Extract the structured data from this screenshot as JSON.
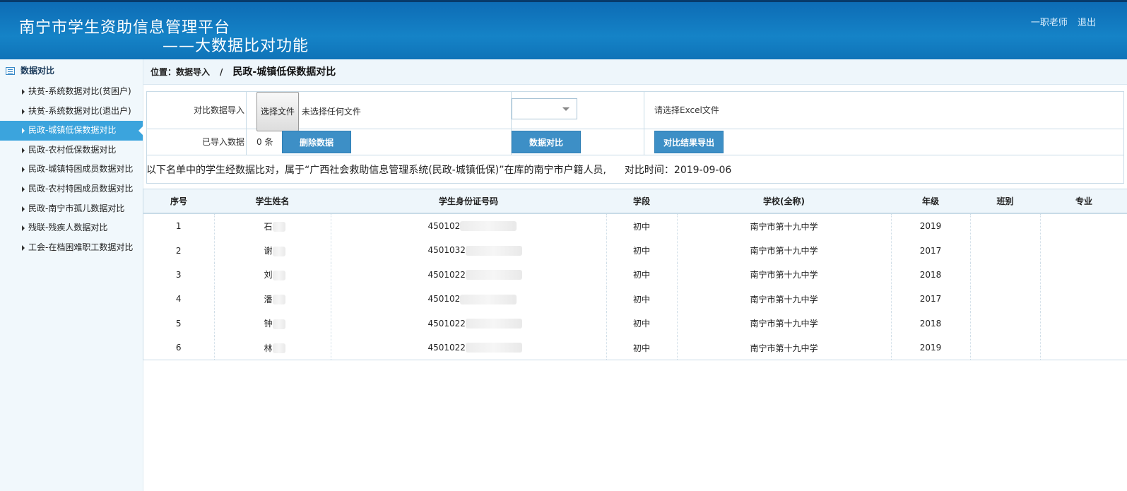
{
  "header": {
    "title": "南宁市学生资助信息管理平台",
    "subtitle": "——大数据比对功能",
    "user": "一职老师",
    "logout": "退出"
  },
  "sidebar": {
    "heading": "数据对比",
    "items": [
      {
        "label": "扶贫-系统数据对比(贫困户)"
      },
      {
        "label": "扶贫-系统数据对比(退出户)"
      },
      {
        "label": "民政-城镇低保数据对比"
      },
      {
        "label": "民政-农村低保数据对比"
      },
      {
        "label": "民政-城镇特困成员数据对比"
      },
      {
        "label": "民政-农村特困成员数据对比"
      },
      {
        "label": "民政-南宁市孤儿数据对比"
      },
      {
        "label": "残联-残疾人数据对比"
      },
      {
        "label": "工会-在档困难职工数据对比"
      }
    ]
  },
  "breadcrumb": {
    "location": "位置：数据导入",
    "separator": "/",
    "current": "民政-城镇低保数据对比"
  },
  "form": {
    "import_label": "对比数据导入",
    "choose_file": "选择文件",
    "no_file": "未选择任何文件",
    "select_value": "",
    "excel_hint": "请选择Excel文件",
    "imported_label": "已导入数据",
    "imported_count": "0 条",
    "delete_button": "删除数据",
    "compare_button": "数据对比",
    "export_button": "对比结果导出"
  },
  "notice": {
    "text": "以下名单中的学生经数据比对，属于“广西社会救助信息管理系统(民政-城镇低保)”在库的南宁市户籍人员,",
    "time": "对比时间：2019-09-06"
  },
  "table": {
    "headers": [
      "序号",
      "学生姓名",
      "学生身份证号码",
      "学段",
      "学校(全称)",
      "年级",
      "班别",
      "专业"
    ],
    "rows": [
      {
        "no": "1",
        "name": "石",
        "id": "450102",
        "stage": "初中",
        "school": "南宁市第十九中学",
        "grade": "2019",
        "class": "",
        "major": ""
      },
      {
        "no": "2",
        "name": "谢",
        "id": "4501032",
        "stage": "初中",
        "school": "南宁市第十九中学",
        "grade": "2017",
        "class": "",
        "major": ""
      },
      {
        "no": "3",
        "name": "刘",
        "id": "4501022",
        "stage": "初中",
        "school": "南宁市第十九中学",
        "grade": "2018",
        "class": "",
        "major": ""
      },
      {
        "no": "4",
        "name": "潘",
        "id": "450102",
        "stage": "初中",
        "school": "南宁市第十九中学",
        "grade": "2017",
        "class": "",
        "major": ""
      },
      {
        "no": "5",
        "name": "钟",
        "id": "4501022",
        "stage": "初中",
        "school": "南宁市第十九中学",
        "grade": "2018",
        "class": "",
        "major": ""
      },
      {
        "no": "6",
        "name": "林",
        "id": "4501022",
        "stage": "初中",
        "school": "南宁市第十九中学",
        "grade": "2019",
        "class": "",
        "major": ""
      }
    ]
  }
}
